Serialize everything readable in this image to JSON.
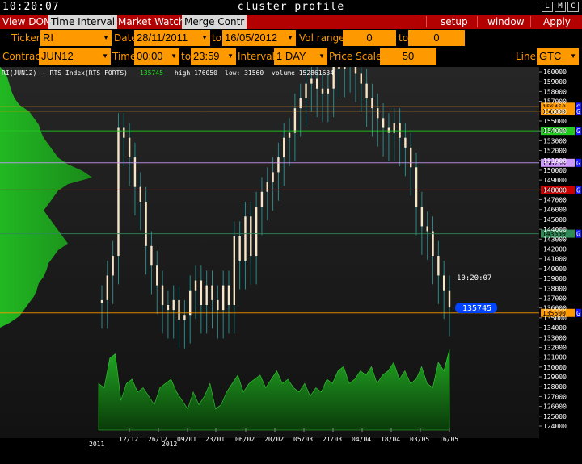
{
  "titlebar": {
    "clock": "10:20:07",
    "title": "cluster profile",
    "window_buttons": [
      "L",
      "M",
      "C"
    ]
  },
  "menu": {
    "view_dom": "View DOM",
    "time_interval": "Time Interval",
    "market_watch": "Market Watch",
    "merge_contr": "Merge Contr",
    "setup": "setup",
    "window": "window",
    "apply": "Apply"
  },
  "controls": {
    "ticker_label": "Ticker",
    "ticker_value": "RI",
    "date_label": "Date",
    "date_from": "28/11/2011",
    "to1": "to",
    "date_to": "16/05/2012",
    "vol_range_label": "Vol range",
    "vol_from": "0",
    "to2": "to",
    "vol_to": "0",
    "contract_label": "Contract",
    "contract_value": "JUN12",
    "time_label": "Time",
    "time_from": "00:00",
    "to3": "to",
    "time_to": "23:59",
    "interval_label": "Interval",
    "interval_value": "1 DAY",
    "price_scale_label": "Price Scale",
    "price_scale_value": "50",
    "line_label": "Line",
    "line_value": "GTC"
  },
  "chart_info": {
    "symbol": "RI(JUN12)",
    "index": "- RTS Index(RTS FORTS)",
    "last": "135745",
    "high": "high 176050",
    "low": "low: 31560",
    "volume": "volume 152861634",
    "cursor_time": "10:20:07",
    "cursor_price": "135745"
  },
  "chart_data": {
    "type": "line",
    "y_axis": {
      "min": 124000,
      "max": 160000,
      "ticks": [
        160000,
        159000,
        158000,
        157000,
        156000,
        155000,
        154000,
        153000,
        152000,
        151000,
        150000,
        149000,
        148000,
        147000,
        146000,
        145000,
        144000,
        143000,
        142000,
        141000,
        140000,
        139000,
        138000,
        137000,
        136000,
        135000,
        134000,
        133000,
        132000,
        131000,
        130000,
        129000,
        128000,
        127000,
        126000,
        125000,
        124000
      ]
    },
    "x_labels": [
      "12/12",
      "26/12",
      "09/01",
      "23/01",
      "06/02",
      "20/02",
      "05/03",
      "21/03",
      "04/04",
      "18/04",
      "03/05",
      "16/05"
    ],
    "year_labels": [
      "2011",
      "2012"
    ],
    "levels": [
      {
        "price": "156450",
        "color": "#ff9900"
      },
      {
        "price": "156000",
        "color": "#ff9900"
      },
      {
        "price": "154000",
        "color": "#22cc22"
      },
      {
        "price": "150750",
        "color": "#cc99ff"
      },
      {
        "price": "148000",
        "color": "#cc0000"
      },
      {
        "price": "143550",
        "color": "#2e8b57"
      },
      {
        "price": "135500",
        "color": "#ff9900"
      }
    ],
    "close_series": [
      136500,
      139000,
      141000,
      154000,
      153000,
      151000,
      148000,
      146500,
      142000,
      140000,
      138000,
      136000,
      135500,
      136500,
      134500,
      135000,
      137500,
      138500,
      136000,
      138000,
      136500,
      135500,
      138000,
      136000,
      143000,
      140500,
      145000,
      141000,
      146000,
      147500,
      148500,
      149500,
      151000,
      153000,
      153500,
      156000,
      157000,
      158500,
      159000,
      158000,
      157500,
      158000,
      160500,
      160000,
      160500,
      161000,
      159500,
      158500,
      157000,
      156000,
      155000,
      154000,
      153500,
      154500,
      153000,
      152000,
      150000,
      146000,
      144000,
      143500,
      141000,
      139000,
      137500,
      135745
    ],
    "volume_series": [
      0.55,
      0.5,
      0.85,
      0.9,
      0.35,
      0.55,
      0.6,
      0.45,
      0.5,
      0.4,
      0.3,
      0.5,
      0.55,
      0.6,
      0.45,
      0.35,
      0.25,
      0.45,
      0.3,
      0.4,
      0.55,
      0.25,
      0.3,
      0.45,
      0.55,
      0.65,
      0.45,
      0.55,
      0.6,
      0.65,
      0.5,
      0.6,
      0.7,
      0.55,
      0.6,
      0.5,
      0.45,
      0.55,
      0.4,
      0.5,
      0.45,
      0.6,
      0.55,
      0.7,
      0.75,
      0.55,
      0.6,
      0.7,
      0.65,
      0.75,
      0.55,
      0.65,
      0.7,
      0.8,
      0.6,
      0.7,
      0.55,
      0.6,
      0.75,
      0.55,
      0.5,
      0.8,
      0.7,
      0.95
    ],
    "profile_series": [
      0.05,
      0.08,
      0.1,
      0.12,
      0.15,
      0.2,
      0.3,
      0.35,
      0.4,
      0.42,
      0.45,
      0.5,
      0.55,
      0.6,
      0.7,
      0.85,
      0.95,
      0.7,
      0.6,
      0.55,
      0.5,
      0.45,
      0.5,
      0.55,
      0.6,
      0.65,
      0.7,
      0.6,
      0.55,
      0.5,
      0.48,
      0.45,
      0.4,
      0.38,
      0.35,
      0.3,
      0.25,
      0.2,
      0.1
    ]
  }
}
